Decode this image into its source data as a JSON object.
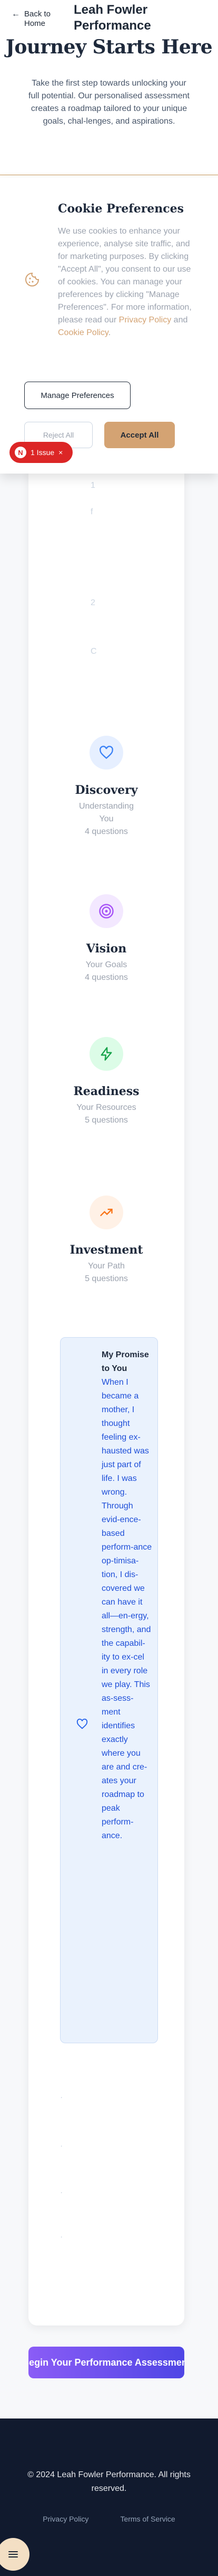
{
  "header": {
    "back_label": "Back to Home",
    "brand": "Leah Fowler Performance"
  },
  "hero": {
    "title": "Journey Starts Here",
    "intro": "Take the first step towards unlocking your full potential. Our personalised assessment creates a roadmap tailored to your unique goals, chal-lenges, and aspirations."
  },
  "cookie": {
    "title": "Cookie Preferences",
    "text_before": "We use cookies to enhance your experience, analyse site traffic, and for marketing purposes. By clicking \"Accept All\", you consent to our use of cookies. You can manage your preferences by clicking \"Manage Preferences\". For more information, please read our ",
    "privacy_link": "Privacy Policy",
    "and": " and ",
    "cookie_link": "Cookie Policy",
    "period": ".",
    "manage_label": "Manage Preferences",
    "reject_label": "Reject All",
    "accept_label": "Accept All"
  },
  "issue_badge": {
    "logo": "N",
    "label": "1 Issue",
    "close": "×"
  },
  "card_marks": [
    "1",
    "f",
    "2",
    "C"
  ],
  "steps": [
    {
      "title": "Discovery",
      "subtitle": "Understanding You",
      "count": "4 questions",
      "icon": "heart-icon",
      "color": "#3b82f6",
      "bg": "#e6efff"
    },
    {
      "title": "Vision",
      "subtitle": "Your Goals",
      "count": "4 questions",
      "icon": "target-icon",
      "color": "#a855f7",
      "bg": "#f3e8ff"
    },
    {
      "title": "Readiness",
      "subtitle": "Your Resources",
      "count": "5 questions",
      "icon": "lightning-icon",
      "color": "#16a34a",
      "bg": "#dcfce7"
    },
    {
      "title": "Investment",
      "subtitle": "Your Path",
      "count": "5 questions",
      "icon": "trending-up-icon",
      "color": "#f97316",
      "bg": "#fff1e6"
    }
  ],
  "promise": {
    "title": "My Promise to You",
    "body": "When I became a mother, I thought feeling ex-hausted was just part of life. I was wrong. Through evid-ence-based perform-ance op-timisa-tion, I dis-covered we can have it all—en-ergy, strength, and the capabil-ity to ex-cel in every role we play. This as-sess-ment identifies exactly where you are and cre-ates your roadmap to peak perform-ance."
  },
  "dots": [
    "·",
    "·",
    "·",
    "·"
  ],
  "cta": {
    "label": "Begin Your Performance Assessment"
  },
  "footer": {
    "copyright": "© 2024 Leah Fowler Performance. All rights reserved.",
    "links": [
      "Privacy Policy",
      "Terms of Service"
    ]
  }
}
